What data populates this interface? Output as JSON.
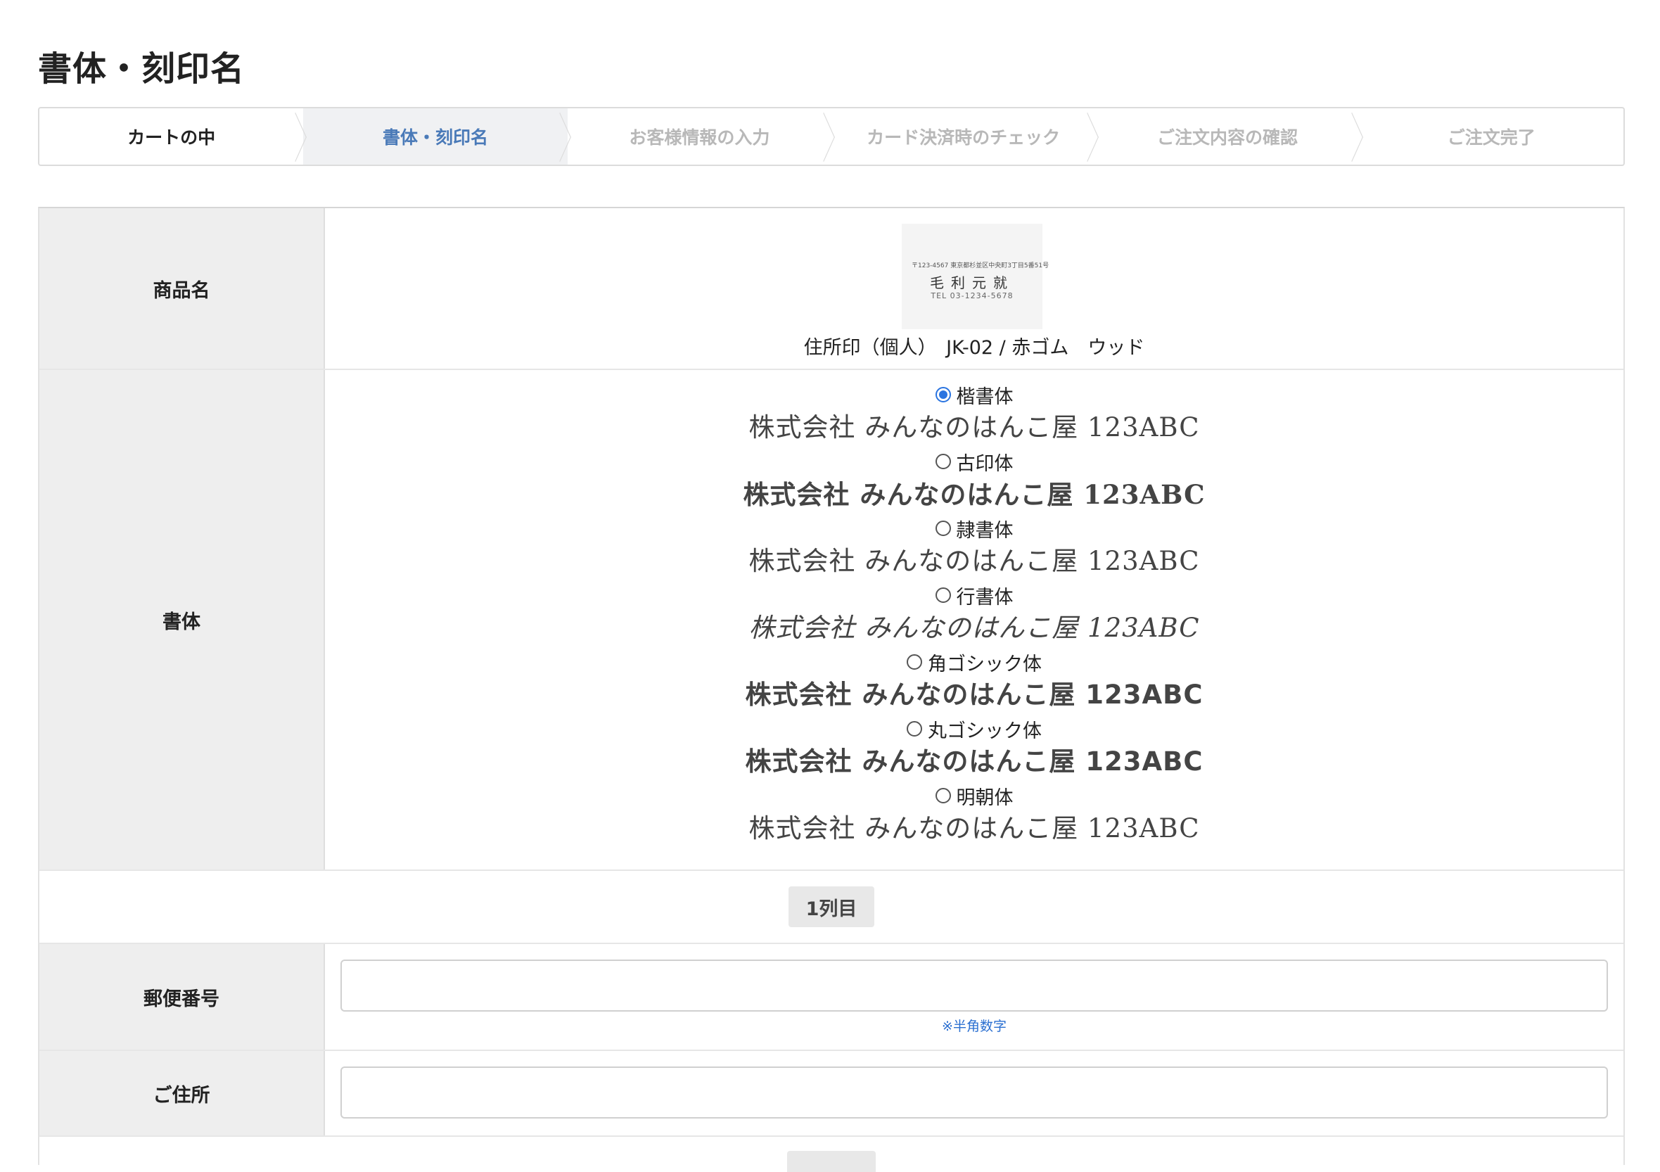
{
  "page_title": "書体・刻印名",
  "steps": [
    {
      "label": "カートの中",
      "state": "done"
    },
    {
      "label": "書体・刻印名",
      "state": "active"
    },
    {
      "label": "お客様情報の入力",
      "state": "pending"
    },
    {
      "label": "カード決済時のチェック",
      "state": "pending"
    },
    {
      "label": "ご注文内容の確認",
      "state": "pending"
    },
    {
      "label": "ご注文完了",
      "state": "pending"
    }
  ],
  "product": {
    "label": "商品名",
    "thumb": {
      "line1": "〒123-4567 東京都杉並区中央町3丁目5番51号",
      "line2": "毛利元就",
      "line3": "TEL 03-1234-5678"
    },
    "name": "住所印（個人）　JK-02 / 赤ゴム　ウッド"
  },
  "font": {
    "label": "書体",
    "selected": "楷書体",
    "sample_text": "株式会社 みんなのはんこ屋 123ABC",
    "options": [
      {
        "name": "楷書体",
        "checked": true
      },
      {
        "name": "古印体",
        "checked": false
      },
      {
        "name": "隷書体",
        "checked": false
      },
      {
        "name": "行書体",
        "checked": false
      },
      {
        "name": "角ゴシック体",
        "checked": false
      },
      {
        "name": "丸ゴシック体",
        "checked": false
      },
      {
        "name": "明朝体",
        "checked": false
      }
    ]
  },
  "column_badge": "1列目",
  "zip": {
    "label": "郵便番号",
    "value": "",
    "note": "※半角数字"
  },
  "address": {
    "label": "ご住所",
    "value": ""
  }
}
